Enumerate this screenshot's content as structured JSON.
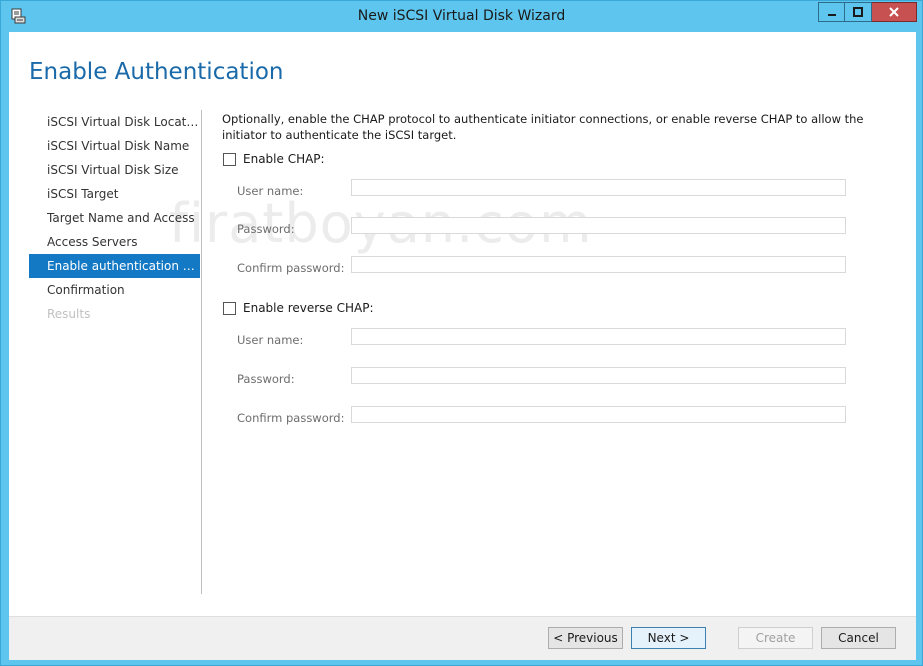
{
  "window": {
    "title": "New iSCSI Virtual Disk Wizard",
    "icon": "wizard-app-icon",
    "controls": {
      "minimize": "minimize-icon",
      "maximize": "maximize-icon",
      "close": "close-icon"
    },
    "colors": {
      "frame": "#5ec6ee",
      "close": "#c75050",
      "accent": "#1479c4",
      "title_text": "#1a6aaa"
    }
  },
  "page": {
    "title": "Enable Authentication",
    "watermark": "firatboyan.com"
  },
  "nav": {
    "items": [
      {
        "label": "iSCSI Virtual Disk Location",
        "state": "normal"
      },
      {
        "label": "iSCSI Virtual Disk Name",
        "state": "normal"
      },
      {
        "label": "iSCSI Virtual Disk Size",
        "state": "normal"
      },
      {
        "label": "iSCSI Target",
        "state": "normal"
      },
      {
        "label": "Target Name and Access",
        "state": "normal"
      },
      {
        "label": "Access Servers",
        "state": "normal"
      },
      {
        "label": "Enable authentication ser...",
        "state": "active"
      },
      {
        "label": "Confirmation",
        "state": "normal"
      },
      {
        "label": "Results",
        "state": "disabled"
      }
    ]
  },
  "content": {
    "description": "Optionally, enable the CHAP protocol to authenticate initiator connections, or enable reverse CHAP to allow the initiator to authenticate the iSCSI target.",
    "chap": {
      "label": "Enable CHAP:",
      "checked": false,
      "username_label": "User name:",
      "username_value": "",
      "password_label": "Password:",
      "password_value": "",
      "confirm_label": "Confirm password:",
      "confirm_value": ""
    },
    "reverse_chap": {
      "label": "Enable reverse CHAP:",
      "checked": false,
      "username_label": "User name:",
      "username_value": "",
      "password_label": "Password:",
      "password_value": "",
      "confirm_label": "Confirm password:",
      "confirm_value": ""
    }
  },
  "footer": {
    "previous": "< Previous",
    "next": "Next >",
    "create": "Create",
    "cancel": "Cancel"
  }
}
